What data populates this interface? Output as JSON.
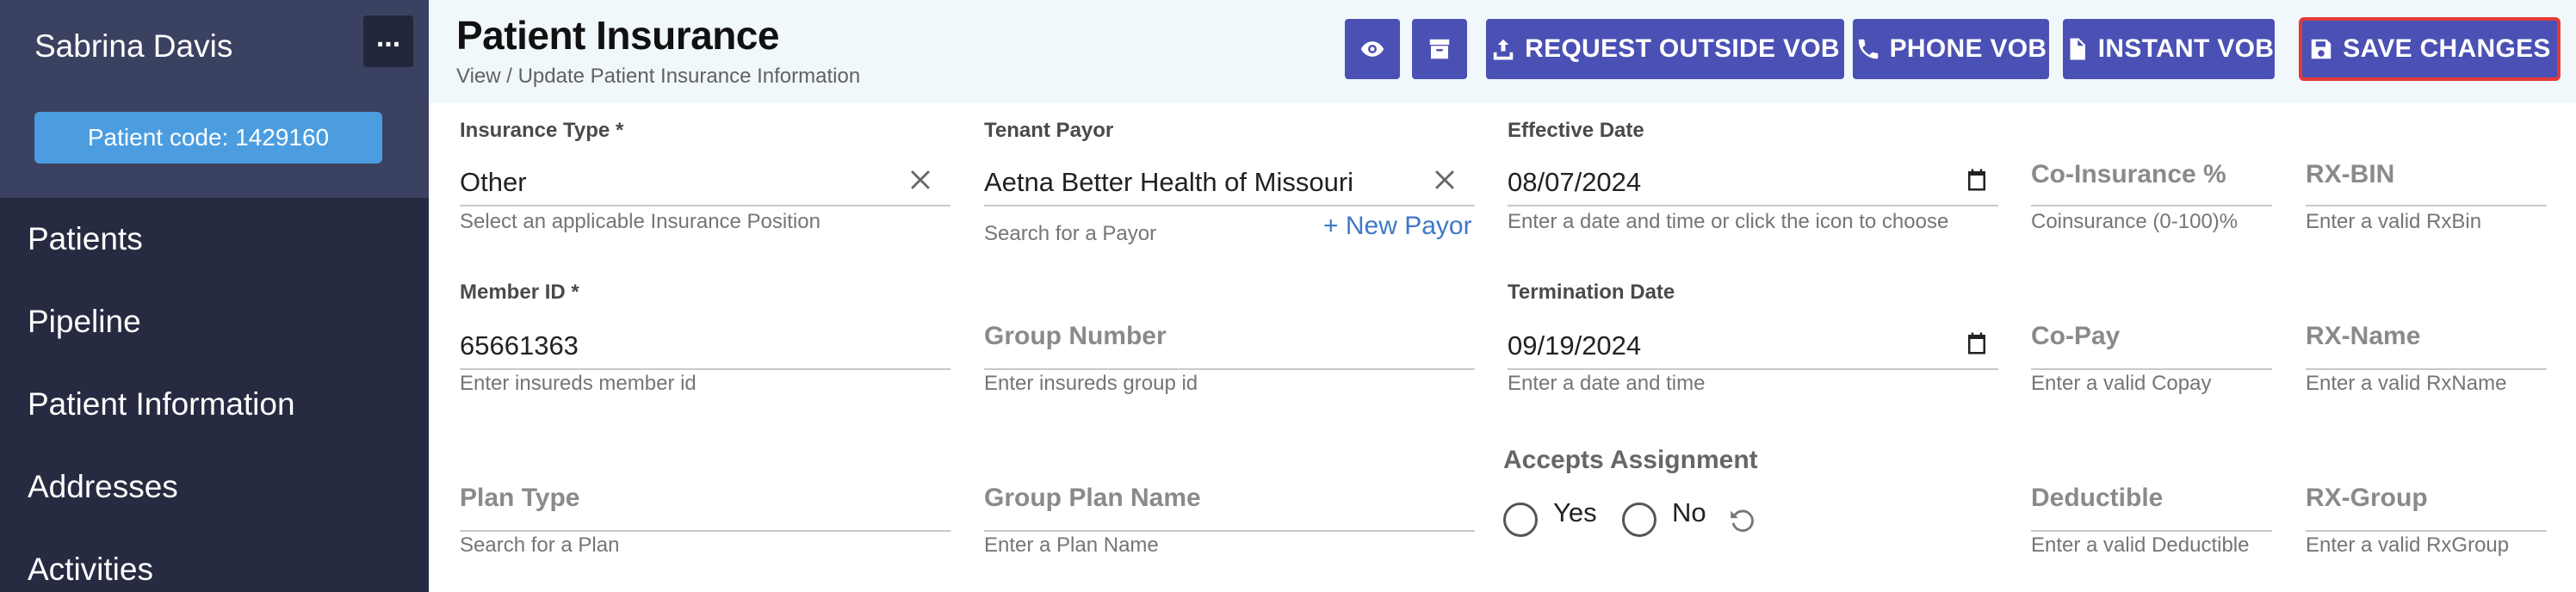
{
  "sidebar": {
    "user_name": "Sabrina Davis",
    "menu_button": "...",
    "patient_code": "Patient code: 1429160",
    "nav": [
      "Patients",
      "Pipeline",
      "Patient Information",
      "Addresses",
      "Activities"
    ]
  },
  "header": {
    "title": "Patient Insurance",
    "subtitle": "View / Update Patient Insurance Information",
    "buttons": {
      "view_icon": "eye-icon",
      "archive_icon": "archive-icon",
      "request_outside_vob": "REQUEST OUTSIDE VOB",
      "phone_vob": "PHONE VOB",
      "instant_vob": "INSTANT VOB",
      "save_changes": "SAVE CHANGES"
    },
    "accent_color": "#4a50b4",
    "highlight_color": "#e53935"
  },
  "form": {
    "insurance_type": {
      "label": "Insurance Type *",
      "value": "Other",
      "helper": "Select an applicable Insurance Position"
    },
    "tenant_payor": {
      "label": "Tenant Payor",
      "value": "Aetna Better Health of Missouri",
      "helper": "Search for a Payor",
      "new_link": "+ New Payor"
    },
    "effective_date": {
      "label": "Effective Date",
      "value": "08/07/2024",
      "helper": "Enter a date and time or click the icon to choose"
    },
    "co_insurance": {
      "placeholder": "Co-Insurance %",
      "helper": "Coinsurance (0-100)%"
    },
    "rx_bin": {
      "placeholder": "RX-BIN",
      "helper": "Enter a valid RxBin"
    },
    "member_id": {
      "label": "Member ID *",
      "value": "65661363",
      "helper": "Enter insureds member id"
    },
    "group_number": {
      "placeholder": "Group Number",
      "helper": "Enter insureds group id"
    },
    "termination_date": {
      "label": "Termination Date",
      "value": "09/19/2024",
      "helper": "Enter a date and time"
    },
    "co_pay": {
      "placeholder": "Co-Pay",
      "helper": "Enter a valid Copay"
    },
    "rx_name": {
      "placeholder": "RX-Name",
      "helper": "Enter a valid RxName"
    },
    "plan_type": {
      "placeholder": "Plan Type",
      "helper": "Search for a Plan"
    },
    "group_plan_name": {
      "placeholder": "Group Plan Name",
      "helper": "Enter a Plan Name"
    },
    "accepts_assignment": {
      "label": "Accepts Assignment",
      "yes": "Yes",
      "no": "No"
    },
    "deductible": {
      "placeholder": "Deductible",
      "helper": "Enter a valid Deductible"
    },
    "rx_group": {
      "placeholder": "RX-Group",
      "helper": "Enter a valid RxGroup"
    }
  }
}
